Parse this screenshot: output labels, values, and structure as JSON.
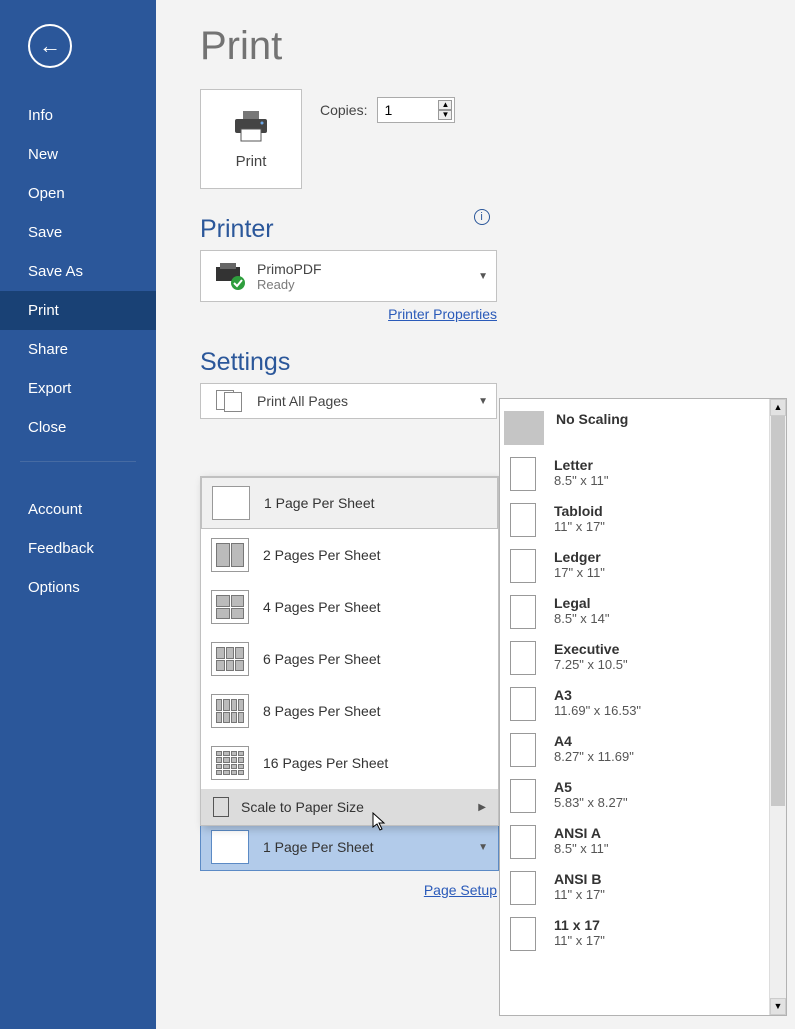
{
  "sidebar": {
    "items": [
      "Info",
      "New",
      "Open",
      "Save",
      "Save As",
      "Print",
      "Share",
      "Export",
      "Close"
    ],
    "active_index": 5,
    "lower_items": [
      "Account",
      "Feedback",
      "Options"
    ]
  },
  "page_title": "Print",
  "print_button": "Print",
  "copies": {
    "label": "Copies:",
    "value": "1"
  },
  "printer": {
    "heading": "Printer",
    "name": "PrimoPDF",
    "status": "Ready",
    "properties_link": "Printer Properties"
  },
  "settings": {
    "heading": "Settings",
    "print_what": {
      "label": "Print All Pages"
    },
    "pps_menu": [
      "1 Page Per Sheet",
      "2 Pages Per Sheet",
      "4 Pages Per Sheet",
      "6 Pages Per Sheet",
      "8 Pages Per Sheet",
      "16 Pages Per Sheet"
    ],
    "pps_selected_index": 0,
    "scale_to_paper_label": "Scale to Paper Size",
    "pps_current_label": "1 Page Per Sheet",
    "page_setup_link": "Page Setup"
  },
  "paper_sizes": [
    {
      "title": "No Scaling",
      "sub": "",
      "no_swatch": true
    },
    {
      "title": "Letter",
      "sub": "8.5\" x 11\""
    },
    {
      "title": "Tabloid",
      "sub": "11\" x 17\""
    },
    {
      "title": "Ledger",
      "sub": "17\" x 11\""
    },
    {
      "title": "Legal",
      "sub": "8.5\" x 14\""
    },
    {
      "title": "Executive",
      "sub": "7.25\" x 10.5\""
    },
    {
      "title": "A3",
      "sub": "11.69\" x 16.53\""
    },
    {
      "title": "A4",
      "sub": "8.27\" x 11.69\""
    },
    {
      "title": "A5",
      "sub": "5.83\" x 8.27\""
    },
    {
      "title": "ANSI A",
      "sub": "8.5\" x 11\""
    },
    {
      "title": "ANSI B",
      "sub": "11\" x 17\""
    },
    {
      "title": "11 x 17",
      "sub": "11\" x 17\""
    }
  ],
  "pps_grid_defs": [
    [
      1,
      1
    ],
    [
      1,
      2
    ],
    [
      2,
      2
    ],
    [
      2,
      3
    ],
    [
      2,
      4
    ],
    [
      4,
      4
    ]
  ]
}
